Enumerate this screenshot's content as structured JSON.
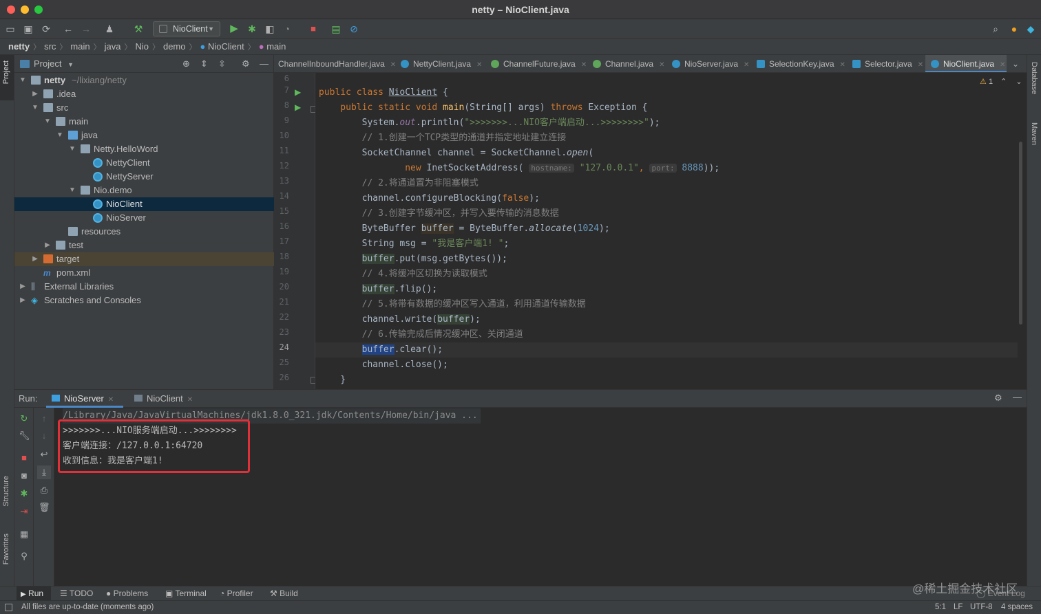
{
  "window": {
    "title": "netty – NioClient.java"
  },
  "toolbar": {
    "run_config": "NioClient"
  },
  "breadcrumb": [
    "netty",
    "src",
    "main",
    "java",
    "Nio",
    "demo",
    "NioClient",
    "main"
  ],
  "project": {
    "header": "Project",
    "tree": [
      {
        "label": "netty",
        "path": "~/lixiang/netty"
      },
      {
        "label": ".idea"
      },
      {
        "label": "src"
      },
      {
        "label": "main"
      },
      {
        "label": "java"
      },
      {
        "label": "Netty.HelloWord"
      },
      {
        "label": "NettyClient"
      },
      {
        "label": "NettyServer"
      },
      {
        "label": "Nio.demo"
      },
      {
        "label": "NioClient"
      },
      {
        "label": "NioServer"
      },
      {
        "label": "resources"
      },
      {
        "label": "test"
      },
      {
        "label": "target"
      },
      {
        "label": "pom.xml"
      },
      {
        "label": "External Libraries"
      },
      {
        "label": "Scratches and Consoles"
      }
    ]
  },
  "left_stripe": {
    "project": "Project",
    "structure": "Structure",
    "favorites": "Favorites"
  },
  "right_stripe": {
    "database": "Database",
    "maven": "Maven"
  },
  "editor": {
    "tabs": [
      "ChannelInboundHandler.java",
      "NettyClient.java",
      "ChannelFuture.java",
      "Channel.java",
      "NioServer.java",
      "SelectionKey.java",
      "Selector.java",
      "NioClient.java"
    ],
    "active_tab": "NioClient.java",
    "warnings": "1",
    "line_numbers": [
      "6",
      "7",
      "8",
      "9",
      "10",
      "11",
      "12",
      "13",
      "14",
      "15",
      "16",
      "17",
      "18",
      "19",
      "20",
      "21",
      "22",
      "23",
      "24",
      "25",
      "26"
    ],
    "code": {
      "l7a": "public class ",
      "l7b": "NioClient",
      "l7c": " {",
      "l8a": "    public static void ",
      "l8b": "main",
      "l8c": "(String[] args) ",
      "l8d": "throws",
      "l8e": " Exception {",
      "l9a": "        System.",
      "l9b": "out",
      "l9c": ".println(",
      "l9d": "\">>>>>>>...NIO客户端启动...>>>>>>>>\"",
      "l9e": ");",
      "l10": "        // 1.创建一个TCP类型的通道并指定地址建立连接",
      "l11a": "        SocketChannel channel = SocketChannel.",
      "l11b": "open",
      "l11c": "(",
      "l12a": "                ",
      "l12b": "new",
      "l12c": " InetSocketAddress( ",
      "l12d": "hostname:",
      "l12e": " \"127.0.0.1\"",
      "l12f": ", ",
      "l12g": "port:",
      "l12h": " 8888",
      "l12i": "));",
      "l13": "        // 2.将通道置为非阻塞模式",
      "l14a": "        channel.configureBlocking(",
      "l14b": "false",
      "l14c": ");",
      "l15": "        // 3.创建字节缓冲区，并写入要传输的消息数据",
      "l16a": "        ByteBuffer ",
      "l16b": "buffer",
      "l16c": " = ByteBuffer.",
      "l16d": "allocate",
      "l16e": "(",
      "l16f": "1024",
      "l16g": ");",
      "l17a": "        String msg = ",
      "l17b": "\"我是客户端1! \"",
      "l17c": ";",
      "l18a": "        ",
      "l18b": "buffer",
      "l18c": ".put(msg.getBytes());",
      "l19": "        // 4.将缓冲区切换为读取模式",
      "l20a": "        ",
      "l20b": "buffer",
      "l20c": ".flip();",
      "l21": "        // 5.将带有数据的缓冲区写入通道，利用通道传输数据",
      "l22a": "        channel.write(",
      "l22b": "buffer",
      "l22c": ");",
      "l23": "        // 6.传输完成后情况缓冲区、关闭通道",
      "l24a": "        ",
      "l24b": "buffer",
      "l24c": ".clear();",
      "l25": "        channel.close();",
      "l26": "    }"
    }
  },
  "run": {
    "label": "Run:",
    "tabs": [
      "NioServer",
      "NioClient"
    ],
    "output": [
      "/Library/Java/JavaVirtualMachines/jdk1.8.0_321.jdk/Contents/Home/bin/java ...",
      ">>>>>>>...NIO服务端启动...>>>>>>>>",
      "客户端连接：/127.0.0.1:64720",
      "收到信息：我是客户端1!"
    ]
  },
  "bottom_tabs": [
    "Run",
    "TODO",
    "Problems",
    "Terminal",
    "Profiler",
    "Build"
  ],
  "event_log": "Event Log",
  "watermark": "@稀土掘金技术社区",
  "status": {
    "message": "All files are up-to-date (moments ago)",
    "position": "5:1",
    "line_sep": "LF",
    "encoding": "UTF-8",
    "indent": "4 spaces"
  },
  "colors": {
    "selection": "#0d293e",
    "highlight_box": "#e0303a",
    "keyword": "#cc7832",
    "string": "#6a8759"
  }
}
